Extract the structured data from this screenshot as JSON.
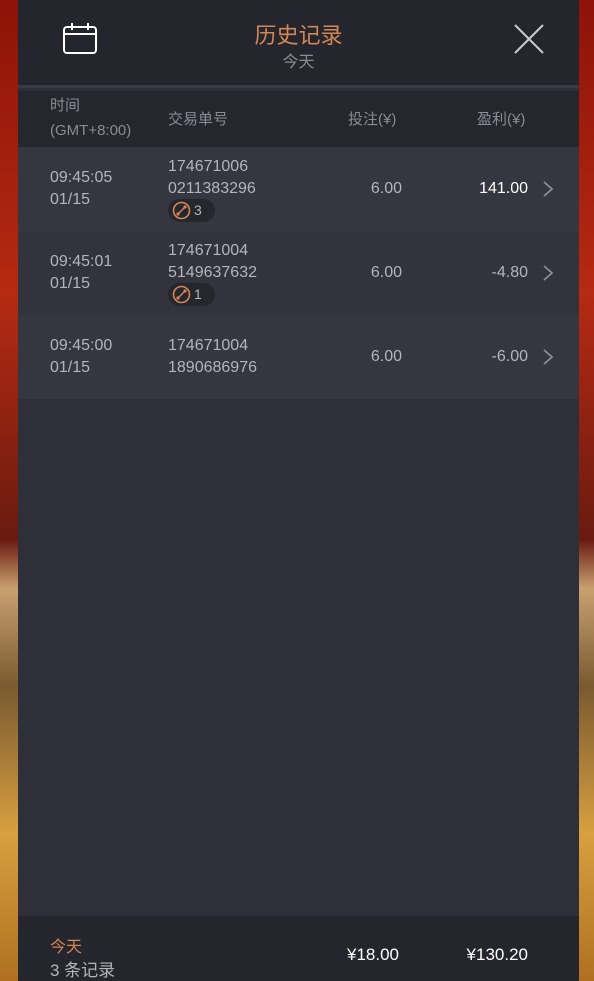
{
  "header": {
    "title": "历史记录",
    "subtitle": "今天",
    "calendar_icon": "calendar-icon",
    "close_icon": "close-icon"
  },
  "columns": {
    "time": "时间",
    "timezone": "(GMT+8:00)",
    "order_id": "交易单号",
    "bet": "投注(¥)",
    "profit": "盈利(¥)"
  },
  "rows": [
    {
      "time": "09:45:05",
      "date": "01/15",
      "order_line1": "174671006",
      "order_line2": "0211383296",
      "badge_count": "3",
      "bet": "6.00",
      "profit": "141.00"
    },
    {
      "time": "09:45:01",
      "date": "01/15",
      "order_line1": "174671004",
      "order_line2": "5149637632",
      "badge_count": "1",
      "bet": "6.00",
      "profit": "-4.80"
    },
    {
      "time": "09:45:00",
      "date": "01/15",
      "order_line1": "174671004",
      "order_line2": "1890686976",
      "bet": "6.00",
      "profit": "-6.00"
    }
  ],
  "footer": {
    "label": "今天",
    "count": "3 条记录",
    "total_bet": "¥18.00",
    "total_profit": "¥130.20"
  },
  "colors": {
    "accent": "#d28855",
    "panel_bg": "#2f2f39",
    "header_bg": "#25252e"
  }
}
